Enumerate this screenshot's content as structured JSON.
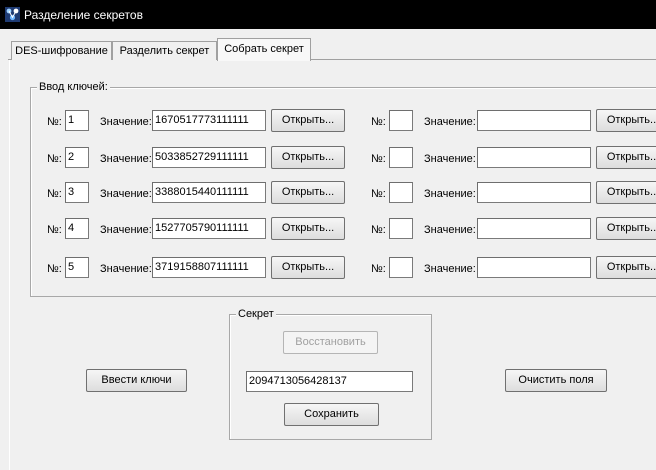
{
  "window": {
    "title": "Разделение секретов",
    "icon": "app-icon"
  },
  "tabs": [
    {
      "label": "DES-шифрование",
      "active": false
    },
    {
      "label": "Разделить секрет",
      "active": false
    },
    {
      "label": "Собрать секрет",
      "active": true
    }
  ],
  "keys_group": {
    "title": "Ввод ключей:",
    "number_label": "№:",
    "value_label": "Значение:",
    "open_label": "Открыть...",
    "left": [
      {
        "num": "1",
        "value": "1670517773111111"
      },
      {
        "num": "2",
        "value": "5033852729111111"
      },
      {
        "num": "3",
        "value": "3388015440111111"
      },
      {
        "num": "4",
        "value": "1527705790111111"
      },
      {
        "num": "5",
        "value": "3719158807111111"
      }
    ],
    "right": [
      {
        "num": "",
        "value": ""
      },
      {
        "num": "",
        "value": ""
      },
      {
        "num": "",
        "value": ""
      },
      {
        "num": "",
        "value": ""
      },
      {
        "num": "",
        "value": ""
      }
    ]
  },
  "secret_group": {
    "title": "Секрет",
    "restore_label": "Восстановить",
    "restore_enabled": false,
    "value": "2094713056428137",
    "save_label": "Сохранить"
  },
  "actions": {
    "enter_keys_label": "Ввести ключи",
    "clear_fields_label": "Очистить поля"
  }
}
